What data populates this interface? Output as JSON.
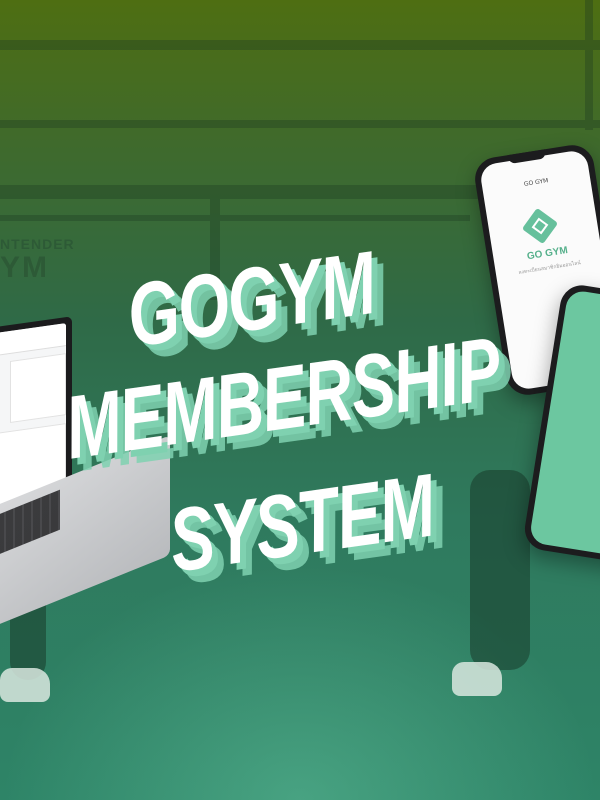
{
  "headline": {
    "line1": "GOGYM",
    "line2": "MEMBERSHIP",
    "line3": "SYSTEM"
  },
  "background_sign": {
    "line1": "NTENDER",
    "line2": "YM"
  },
  "phone_app": {
    "header": "GO GYM",
    "brand": "GO GYM",
    "tagline": "ลงทะเบียนสมาชิกยิมออนไลน์"
  },
  "colors": {
    "accent": "#7fd1b0",
    "phone_screen": "#6cc7a0",
    "background_top": "#4e6e12",
    "background_bottom": "#2e8467"
  }
}
